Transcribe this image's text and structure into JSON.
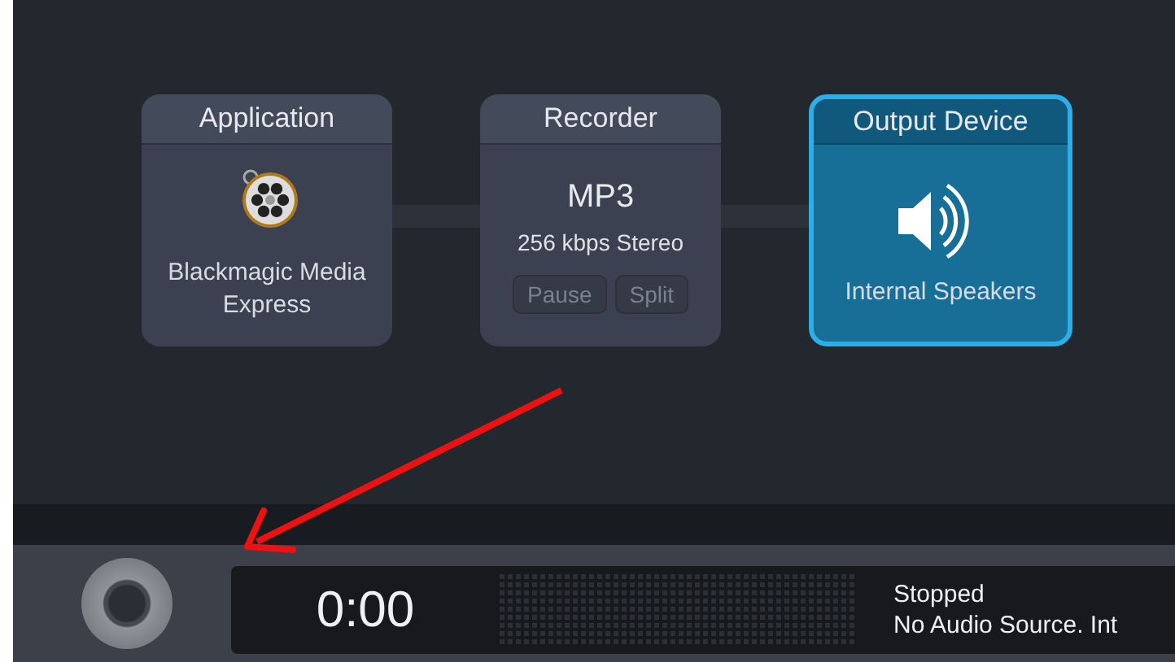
{
  "pipeline": [
    {
      "kind": "application",
      "title": "Application",
      "label": "Blackmagic Media Express",
      "selected": false
    },
    {
      "kind": "recorder",
      "title": "Recorder",
      "format": "MP3",
      "quality": "256 kbps Stereo",
      "buttons": [
        {
          "label": "Pause",
          "disabled": true
        },
        {
          "label": "Split",
          "disabled": true
        }
      ],
      "selected": false
    },
    {
      "kind": "output",
      "title": "Output Device",
      "label": "Internal Speakers",
      "selected": true
    }
  ],
  "transport": {
    "time": "0:00",
    "status": "Stopped",
    "message": "No Audio Source. Int"
  }
}
